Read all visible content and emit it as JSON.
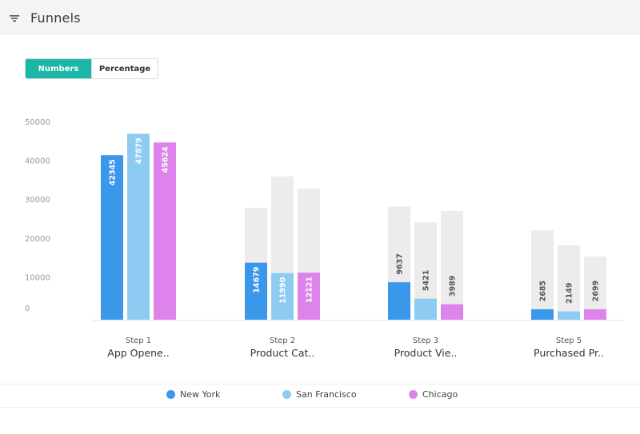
{
  "header": {
    "title": "Funnels",
    "icon": "filter-icon"
  },
  "toggle": {
    "options": [
      "Numbers",
      "Percentage"
    ],
    "selected": "Numbers"
  },
  "colors": {
    "accent": "#1bb7a6",
    "new_york": "#3b97ea",
    "san_francisco": "#8ecbf3",
    "chicago": "#de83ec",
    "background_bar": "#ececec"
  },
  "chart_data": {
    "type": "bar",
    "categories": [
      {
        "step": "Step 1",
        "name": "App Opene.."
      },
      {
        "step": "Step 2",
        "name": "Product Cat.."
      },
      {
        "step": "Step 3",
        "name": "Product Vie.."
      },
      {
        "step": "Step 5",
        "name": "Purchased Pr.."
      }
    ],
    "series": [
      {
        "name": "New York",
        "values": [
          42345,
          14679,
          9637,
          2685
        ],
        "previous": [
          null,
          28800,
          29100,
          23000
        ]
      },
      {
        "name": "San Francisco",
        "values": [
          47879,
          11990,
          5421,
          2149
        ],
        "previous": [
          null,
          36900,
          25100,
          19200
        ]
      },
      {
        "name": "Chicago",
        "values": [
          45624,
          12121,
          3989,
          2699
        ],
        "previous": [
          null,
          33800,
          28000,
          16300
        ]
      }
    ],
    "yticks": [
      0,
      10000,
      20000,
      30000,
      40000,
      50000
    ],
    "ylim": [
      0,
      50000
    ],
    "legend": "bottom",
    "grid": false
  }
}
